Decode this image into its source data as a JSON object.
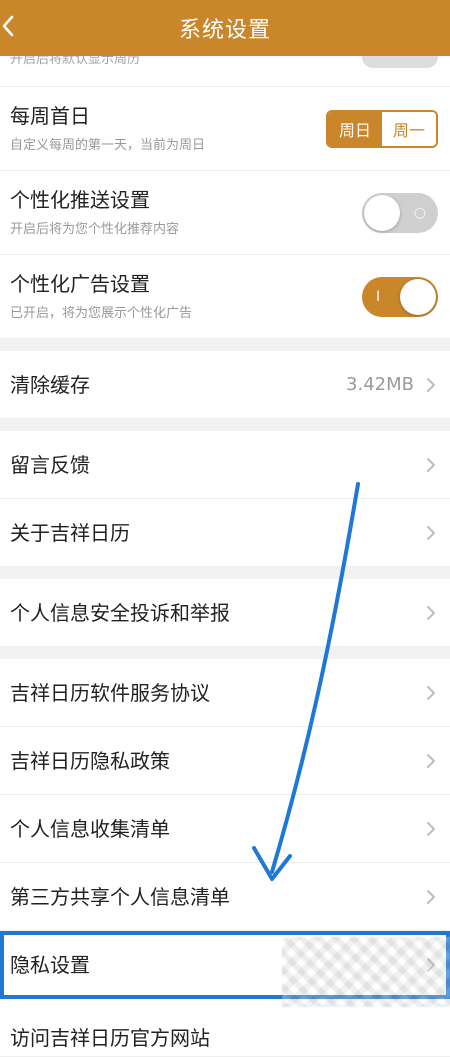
{
  "header": {
    "title": "系统设置",
    "back_icon": "chevron-left-icon"
  },
  "peek": {
    "partial_text": "开启后将默认显示周历"
  },
  "week_start": {
    "label": "每周首日",
    "desc": "自定义每周的第一天，当前为周日",
    "options": [
      "周日",
      "周一"
    ],
    "selected": "周日"
  },
  "personalized_push": {
    "label": "个性化推送设置",
    "desc": "开启后将为您个性化推荐内容",
    "enabled": false
  },
  "personalized_ads": {
    "label": "个性化广告设置",
    "desc": "已开启，将为您展示个性化广告",
    "enabled": true
  },
  "cache": {
    "label": "清除缓存",
    "size": "3.42MB"
  },
  "items": [
    {
      "label": "留言反馈"
    },
    {
      "label": "关于吉祥日历"
    },
    {
      "label": "个人信息安全投诉和举报"
    },
    {
      "label": "吉祥日历软件服务协议"
    },
    {
      "label": "吉祥日历隐私政策"
    },
    {
      "label": "个人信息收集清单"
    },
    {
      "label": "第三方共享个人信息清单"
    },
    {
      "label": "隐私设置"
    },
    {
      "label": "访问吉祥日历官方网站"
    }
  ],
  "colors": {
    "accent": "#c9862a",
    "highlight": "#1f78d6"
  }
}
